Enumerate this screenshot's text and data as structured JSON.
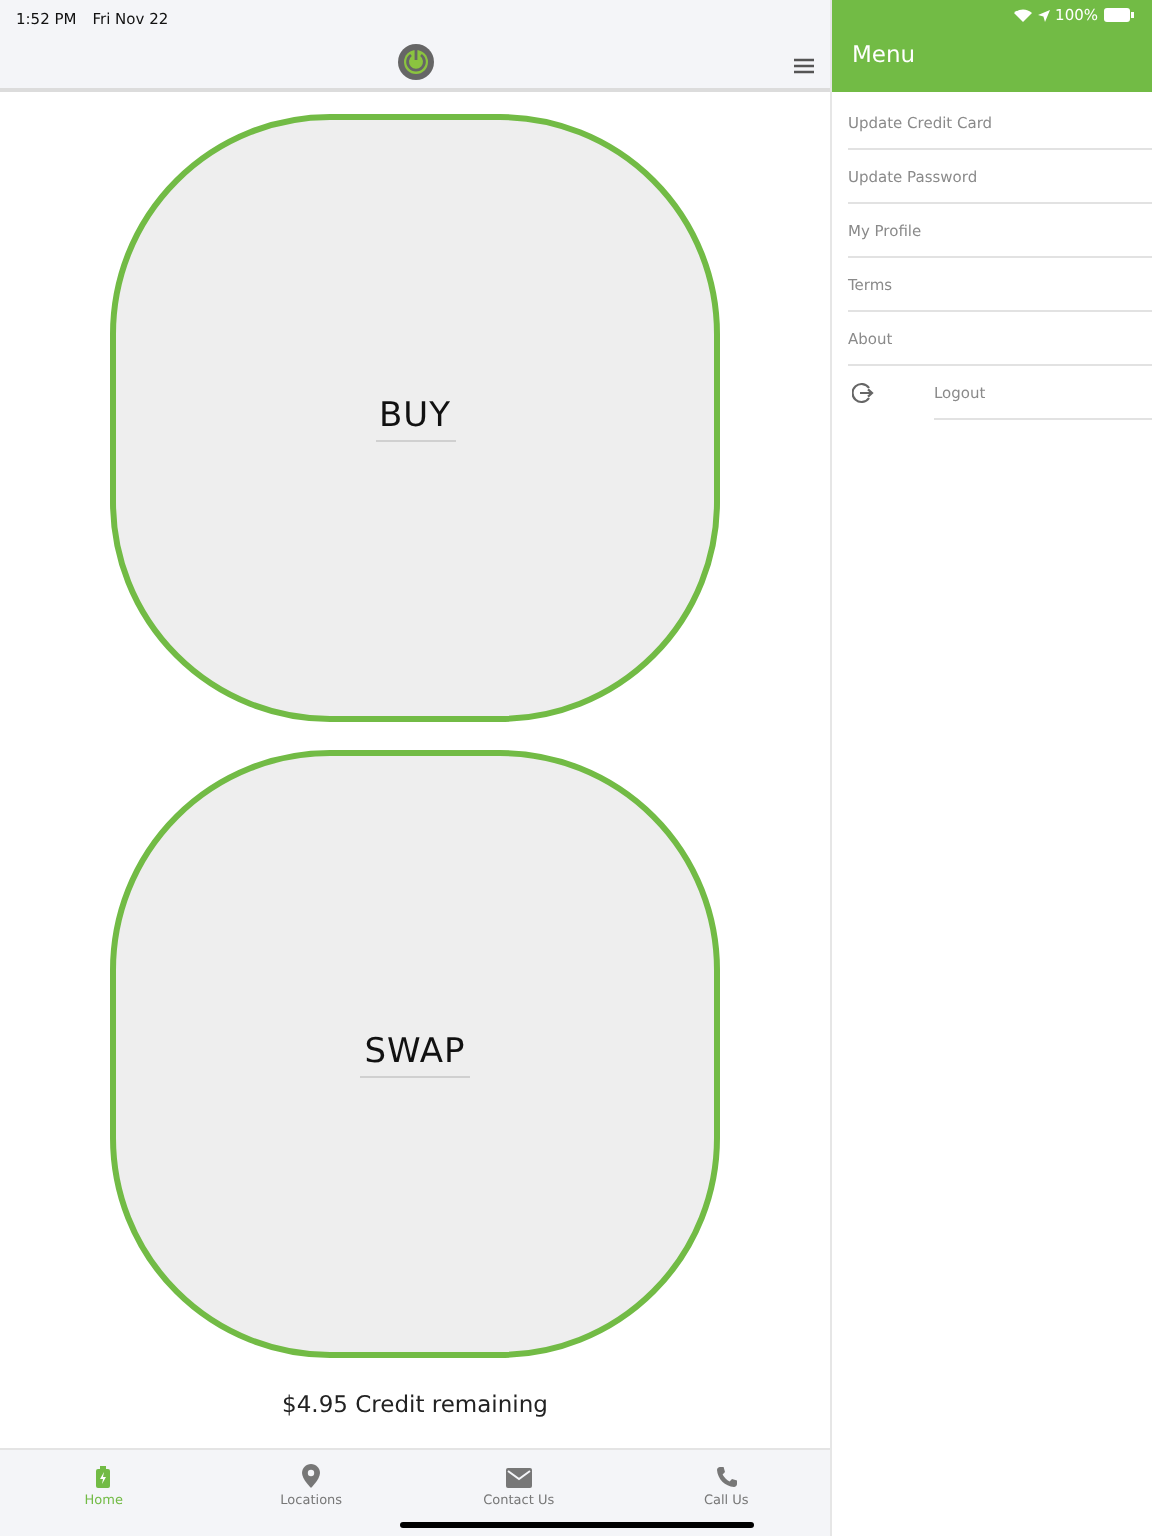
{
  "status_bar": {
    "time": "1:52 PM",
    "date": "Fri Nov 22",
    "battery": "100%"
  },
  "tiles": [
    {
      "label": "BUY"
    },
    {
      "label": "SWAP"
    }
  ],
  "credit": "$4.95 Credit remaining",
  "tabs": [
    {
      "label": "Home",
      "kind": "battery",
      "selected": true
    },
    {
      "label": "Locations",
      "kind": "pin",
      "selected": false
    },
    {
      "label": "Contact Us",
      "kind": "mail",
      "selected": false
    },
    {
      "label": "Call Us",
      "kind": "phone",
      "selected": false
    }
  ],
  "menu": {
    "title": "Menu",
    "items": [
      {
        "label": "Update Credit Card",
        "kind": "plain"
      },
      {
        "label": "Update Password",
        "kind": "plain"
      },
      {
        "label": "My Profile",
        "kind": "plain"
      },
      {
        "label": "Terms",
        "kind": "plain"
      },
      {
        "label": "About",
        "kind": "plain"
      },
      {
        "label": "Logout",
        "kind": "logout"
      }
    ]
  }
}
